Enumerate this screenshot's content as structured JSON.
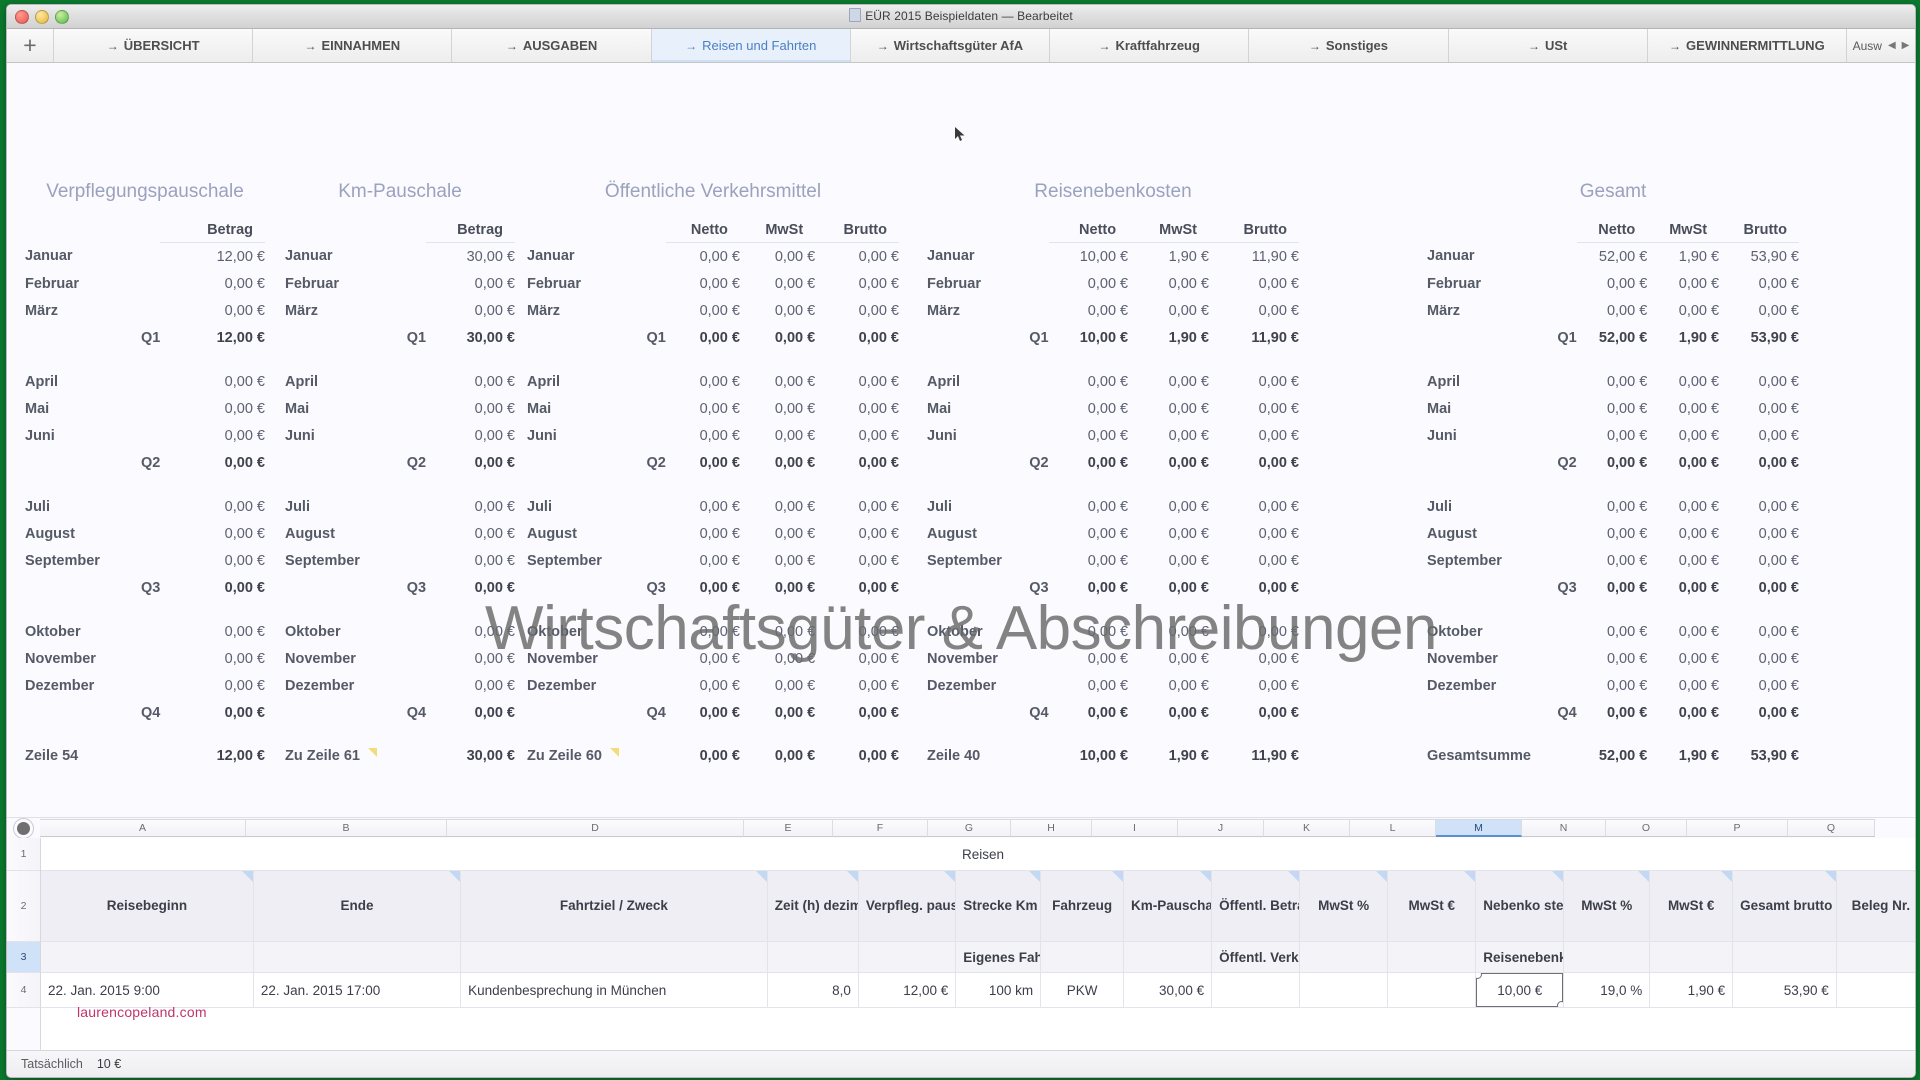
{
  "window": {
    "title": "EÜR 2015 Beispieldaten — Bearbeitet",
    "doc_icon": "document-icon"
  },
  "tabbar": {
    "add_label": "+",
    "arrow": "→",
    "tabs": [
      {
        "label": "ÜBERSICHT",
        "active": false
      },
      {
        "label": "EINNAHMEN",
        "active": false
      },
      {
        "label": "AUSGABEN",
        "active": false
      },
      {
        "label": "Reisen und Fahrten",
        "active": true
      },
      {
        "label": "Wirtschaftsgüter AfA",
        "active": false
      },
      {
        "label": "Kraftfahrzeug",
        "active": false
      },
      {
        "label": "Sonstiges",
        "active": false
      },
      {
        "label": "USt",
        "active": false
      },
      {
        "label": "GEWINNERMITTLUNG",
        "active": false
      }
    ],
    "overflow_label": "Ausw",
    "overflow_prev": "◀",
    "overflow_next": "▶"
  },
  "watermark": "Wirtschaftsgüter & Abschreibungen",
  "site_credit": "laurencopeland.com",
  "months": [
    "Januar",
    "Februar",
    "März",
    "April",
    "Mai",
    "Juni",
    "Juli",
    "August",
    "September",
    "Oktober",
    "November",
    "Dezember"
  ],
  "quarters": [
    "Q1",
    "Q2",
    "Q3",
    "Q4"
  ],
  "summary_groups": [
    {
      "title": "Verpflegungspauschale",
      "columns": [
        "Betrag"
      ],
      "footer_label": "Zeile 54",
      "footer_note": false,
      "rows": {
        "Januar": [
          "12,00 €"
        ],
        "Februar": [
          "0,00 €"
        ],
        "März": [
          "0,00 €"
        ],
        "Q1": [
          "12,00 €"
        ],
        "April": [
          "0,00 €"
        ],
        "Mai": [
          "0,00 €"
        ],
        "Juni": [
          "0,00 €"
        ],
        "Q2": [
          "0,00 €"
        ],
        "Juli": [
          "0,00 €"
        ],
        "August": [
          "0,00 €"
        ],
        "September": [
          "0,00 €"
        ],
        "Q3": [
          "0,00 €"
        ],
        "Oktober": [
          "0,00 €"
        ],
        "November": [
          "0,00 €"
        ],
        "Dezember": [
          "0,00 €"
        ],
        "Q4": [
          "0,00 €"
        ]
      },
      "footer_values": [
        "12,00 €"
      ]
    },
    {
      "title": "Km-Pauschale",
      "columns": [
        "Betrag"
      ],
      "footer_label": "Zu Zeile 61",
      "footer_note": true,
      "rows": {
        "Januar": [
          "30,00 €"
        ],
        "Februar": [
          "0,00 €"
        ],
        "März": [
          "0,00 €"
        ],
        "Q1": [
          "30,00 €"
        ],
        "April": [
          "0,00 €"
        ],
        "Mai": [
          "0,00 €"
        ],
        "Juni": [
          "0,00 €"
        ],
        "Q2": [
          "0,00 €"
        ],
        "Juli": [
          "0,00 €"
        ],
        "August": [
          "0,00 €"
        ],
        "September": [
          "0,00 €"
        ],
        "Q3": [
          "0,00 €"
        ],
        "Oktober": [
          "0,00 €"
        ],
        "November": [
          "0,00 €"
        ],
        "Dezember": [
          "0,00 €"
        ],
        "Q4": [
          "0,00 €"
        ]
      },
      "footer_values": [
        "30,00 €"
      ]
    },
    {
      "title": "Öffentliche Verkehrsmittel",
      "columns": [
        "Netto",
        "MwSt",
        "Brutto"
      ],
      "footer_label": "Zu Zeile 60",
      "footer_note": true,
      "rows": {
        "Januar": [
          "0,00 €",
          "0,00 €",
          "0,00 €"
        ],
        "Februar": [
          "0,00 €",
          "0,00 €",
          "0,00 €"
        ],
        "März": [
          "0,00 €",
          "0,00 €",
          "0,00 €"
        ],
        "Q1": [
          "0,00 €",
          "0,00 €",
          "0,00 €"
        ],
        "April": [
          "0,00 €",
          "0,00 €",
          "0,00 €"
        ],
        "Mai": [
          "0,00 €",
          "0,00 €",
          "0,00 €"
        ],
        "Juni": [
          "0,00 €",
          "0,00 €",
          "0,00 €"
        ],
        "Q2": [
          "0,00 €",
          "0,00 €",
          "0,00 €"
        ],
        "Juli": [
          "0,00 €",
          "0,00 €",
          "0,00 €"
        ],
        "August": [
          "0,00 €",
          "0,00 €",
          "0,00 €"
        ],
        "September": [
          "0,00 €",
          "0,00 €",
          "0,00 €"
        ],
        "Q3": [
          "0,00 €",
          "0,00 €",
          "0,00 €"
        ],
        "Oktober": [
          "0,00 €",
          "0,00 €",
          "0,00 €"
        ],
        "November": [
          "0,00 €",
          "0,00 €",
          "0,00 €"
        ],
        "Dezember": [
          "0,00 €",
          "0,00 €",
          "0,00 €"
        ],
        "Q4": [
          "0,00 €",
          "0,00 €",
          "0,00 €"
        ]
      },
      "footer_values": [
        "0,00 €",
        "0,00 €",
        "0,00 €"
      ]
    },
    {
      "title": "Reisenebenkosten",
      "columns": [
        "Netto",
        "MwSt",
        "Brutto"
      ],
      "footer_label": "Zeile 40",
      "footer_note": false,
      "rows": {
        "Januar": [
          "10,00 €",
          "1,90 €",
          "11,90 €"
        ],
        "Februar": [
          "0,00 €",
          "0,00 €",
          "0,00 €"
        ],
        "März": [
          "0,00 €",
          "0,00 €",
          "0,00 €"
        ],
        "Q1": [
          "10,00 €",
          "1,90 €",
          "11,90 €"
        ],
        "April": [
          "0,00 €",
          "0,00 €",
          "0,00 €"
        ],
        "Mai": [
          "0,00 €",
          "0,00 €",
          "0,00 €"
        ],
        "Juni": [
          "0,00 €",
          "0,00 €",
          "0,00 €"
        ],
        "Q2": [
          "0,00 €",
          "0,00 €",
          "0,00 €"
        ],
        "Juli": [
          "0,00 €",
          "0,00 €",
          "0,00 €"
        ],
        "August": [
          "0,00 €",
          "0,00 €",
          "0,00 €"
        ],
        "September": [
          "0,00 €",
          "0,00 €",
          "0,00 €"
        ],
        "Q3": [
          "0,00 €",
          "0,00 €",
          "0,00 €"
        ],
        "Oktober": [
          "0,00 €",
          "0,00 €",
          "0,00 €"
        ],
        "November": [
          "0,00 €",
          "0,00 €",
          "0,00 €"
        ],
        "Dezember": [
          "0,00 €",
          "0,00 €",
          "0,00 €"
        ],
        "Q4": [
          "0,00 €",
          "0,00 €",
          "0,00 €"
        ]
      },
      "footer_values": [
        "10,00 €",
        "1,90 €",
        "11,90 €"
      ]
    },
    {
      "title": "Gesamt",
      "columns": [
        "Netto",
        "MwSt",
        "Brutto"
      ],
      "footer_label": "Gesamtsumme",
      "footer_note": false,
      "rows": {
        "Januar": [
          "52,00 €",
          "1,90 €",
          "53,90 €"
        ],
        "Februar": [
          "0,00 €",
          "0,00 €",
          "0,00 €"
        ],
        "März": [
          "0,00 €",
          "0,00 €",
          "0,00 €"
        ],
        "Q1": [
          "52,00 €",
          "1,90 €",
          "53,90 €"
        ],
        "April": [
          "0,00 €",
          "0,00 €",
          "0,00 €"
        ],
        "Mai": [
          "0,00 €",
          "0,00 €",
          "0,00 €"
        ],
        "Juni": [
          "0,00 €",
          "0,00 €",
          "0,00 €"
        ],
        "Q2": [
          "0,00 €",
          "0,00 €",
          "0,00 €"
        ],
        "Juli": [
          "0,00 €",
          "0,00 €",
          "0,00 €"
        ],
        "August": [
          "0,00 €",
          "0,00 €",
          "0,00 €"
        ],
        "September": [
          "0,00 €",
          "0,00 €",
          "0,00 €"
        ],
        "Q3": [
          "0,00 €",
          "0,00 €",
          "0,00 €"
        ],
        "Oktober": [
          "0,00 €",
          "0,00 €",
          "0,00 €"
        ],
        "November": [
          "0,00 €",
          "0,00 €",
          "0,00 €"
        ],
        "Dezember": [
          "0,00 €",
          "0,00 €",
          "0,00 €"
        ],
        "Q4": [
          "0,00 €",
          "0,00 €",
          "0,00 €"
        ]
      },
      "footer_values": [
        "52,00 €",
        "1,90 €",
        "53,90 €"
      ]
    }
  ],
  "column_ruler": {
    "letters": [
      "A",
      "B",
      "D",
      "E",
      "F",
      "G",
      "H",
      "I",
      "J",
      "K",
      "L",
      "M",
      "N",
      "O",
      "P",
      "Q"
    ],
    "selected": "M"
  },
  "sheet": {
    "row_numbers": [
      "1",
      "2",
      "3",
      "4"
    ],
    "selected_row": "3",
    "table_title": "Reisen",
    "headers": [
      "Reisebeginn",
      "Ende",
      "Fahrtziel / Zweck",
      "Zeit (h) dezimal",
      "Verpfleg. pauschale",
      "Strecke Km",
      "Fahrzeug",
      "Km-Pauschale",
      "Öffentl. Betrag netto",
      "MwSt %",
      "MwSt €",
      "Nebenko sten netto",
      "MwSt %",
      "MwSt €",
      "Gesamt brutto",
      "Beleg Nr."
    ],
    "subheaders": [
      "",
      "",
      "",
      "",
      "",
      "Eigenes Fahrzeug",
      "",
      "",
      "Öffentl. Verkehrsmittel",
      "",
      "",
      "Reisenebenkosten",
      "",
      "",
      "",
      ""
    ],
    "data_row": [
      "22. Jan. 2015  9:00",
      "22. Jan. 2015  17:00",
      "Kundenbesprechung in München",
      "8,0",
      "12,00 €",
      "100 km",
      "PKW",
      "30,00 €",
      "",
      "",
      "",
      "10,00 €",
      "19,0 %",
      "1,90 €",
      "53,90 €",
      ""
    ],
    "selected_cell_index": 11,
    "selected_cell_value": "10,00 €"
  },
  "statusbar": {
    "label": "Tatsächlich",
    "value": "10 €"
  }
}
